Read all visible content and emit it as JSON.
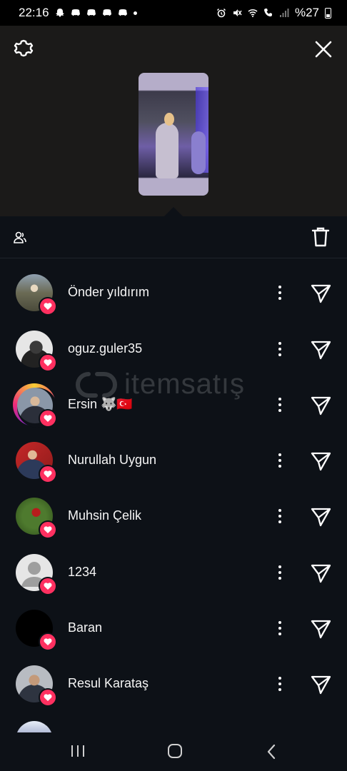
{
  "status_bar": {
    "time": "22:16",
    "battery": "%27",
    "notification_icons": [
      "snapchat-icon",
      "discord-icon",
      "discord-icon",
      "discord-icon",
      "discord-icon"
    ],
    "system_icons": [
      "alarm-icon",
      "mute-icon",
      "wifi-icon",
      "call-icon",
      "signal-icon",
      "battery-icon"
    ]
  },
  "preview": {
    "icons": {
      "settings": "gear-icon",
      "close": "close-icon"
    }
  },
  "action_bar": {
    "icons": {
      "left": "people-icon",
      "right": "trash-icon"
    }
  },
  "watermark": {
    "text": "itemsatış"
  },
  "viewers": [
    {
      "name": "Önder yıldırım",
      "liked": true,
      "story_ring": false,
      "avatar_color": "#6e6a52"
    },
    {
      "name": "oguz.guler35",
      "liked": true,
      "story_ring": false,
      "avatar_color": "#d9d9d9"
    },
    {
      "name": "Ersin 🐺🇹🇷",
      "liked": true,
      "story_ring": true,
      "avatar_color": "#5a6b7d"
    },
    {
      "name": "Nurullah Uygun",
      "liked": true,
      "story_ring": false,
      "avatar_color": "#b03030"
    },
    {
      "name": "Muhsin Çelik",
      "liked": true,
      "story_ring": false,
      "avatar_color": "#3d6b2a"
    },
    {
      "name": "1234",
      "liked": true,
      "story_ring": false,
      "avatar_color": "#e6e6e6"
    },
    {
      "name": "Baran",
      "liked": true,
      "story_ring": false,
      "avatar_color": "#000000"
    },
    {
      "name": "Resul Karataş",
      "liked": true,
      "story_ring": false,
      "avatar_color": "#9a9fa6"
    }
  ],
  "colors": {
    "background": "#0d1117",
    "preview_background": "#1b1a19",
    "heart_badge": "#ff3060"
  },
  "navbar": {
    "icons": [
      "recent-apps-icon",
      "home-icon",
      "back-icon"
    ]
  }
}
